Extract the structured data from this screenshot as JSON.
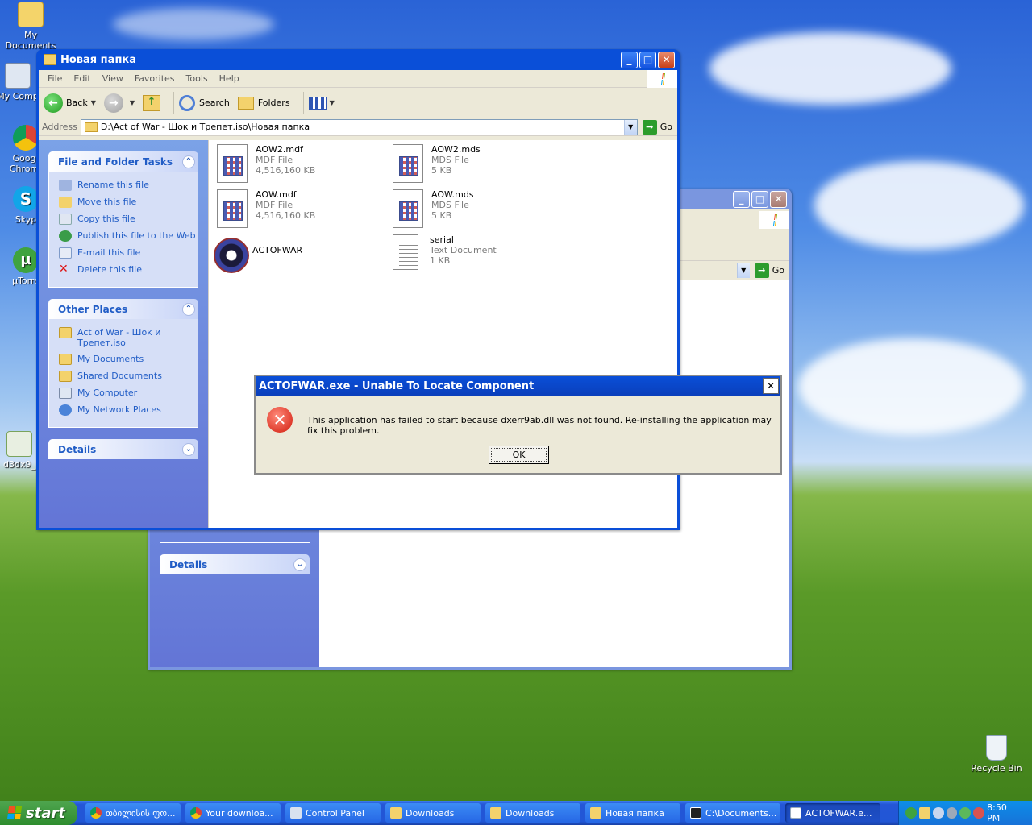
{
  "desktop": {
    "icons": [
      {
        "label": "My Documents"
      },
      {
        "label": "My Comp"
      },
      {
        "label": "Goog Chrom"
      },
      {
        "label": "Skyp"
      },
      {
        "label": "µTorre"
      },
      {
        "label": "d3dx9_"
      },
      {
        "label": "Recycle Bin"
      }
    ]
  },
  "back_window": {
    "go_label": "Go",
    "details_label": "Details"
  },
  "explorer": {
    "title": "Новая папка",
    "menu": [
      "File",
      "Edit",
      "View",
      "Favorites",
      "Tools",
      "Help"
    ],
    "toolbar": {
      "back": "Back",
      "search": "Search",
      "folders": "Folders"
    },
    "address": {
      "label": "Address",
      "value": "D:\\Act of War - Шок и Трепет.iso\\Новая папка",
      "go": "Go"
    },
    "file_tasks": {
      "title": "File and Folder Tasks",
      "items": [
        "Rename this file",
        "Move this file",
        "Copy this file",
        "Publish this file to the Web",
        "E-mail this file",
        "Delete this file"
      ]
    },
    "other_places": {
      "title": "Other Places",
      "items": [
        "Act of War - Шок и Трепет.iso",
        "My Documents",
        "Shared Documents",
        "My Computer",
        "My Network Places"
      ]
    },
    "details_title": "Details",
    "files": [
      {
        "name": "AOW2.mdf",
        "type": "MDF File",
        "size": "4,516,160 KB"
      },
      {
        "name": "AOW2.mds",
        "type": "MDS File",
        "size": "5 KB"
      },
      {
        "name": "AOW.mdf",
        "type": "MDF File",
        "size": "4,516,160 KB"
      },
      {
        "name": "AOW.mds",
        "type": "MDS File",
        "size": "5 KB"
      },
      {
        "name": "ACTOFWAR",
        "type": "",
        "size": ""
      },
      {
        "name": "serial",
        "type": "Text Document",
        "size": "1 KB"
      }
    ]
  },
  "dialog": {
    "title": "ACTOFWAR.exe - Unable To Locate Component",
    "message": "This application has failed to start because dxerr9ab.dll was not found. Re-installing the application may fix this problem.",
    "ok": "OK"
  },
  "taskbar": {
    "start": "start",
    "items": [
      {
        "label": "თბილისის ფო..."
      },
      {
        "label": "Your downloa..."
      },
      {
        "label": "Control Panel"
      },
      {
        "label": "Downloads"
      },
      {
        "label": "Downloads"
      },
      {
        "label": "Новая папка"
      },
      {
        "label": "C:\\Documents..."
      },
      {
        "label": "ACTOFWAR.e..."
      }
    ],
    "clock": "8:50 PM"
  }
}
